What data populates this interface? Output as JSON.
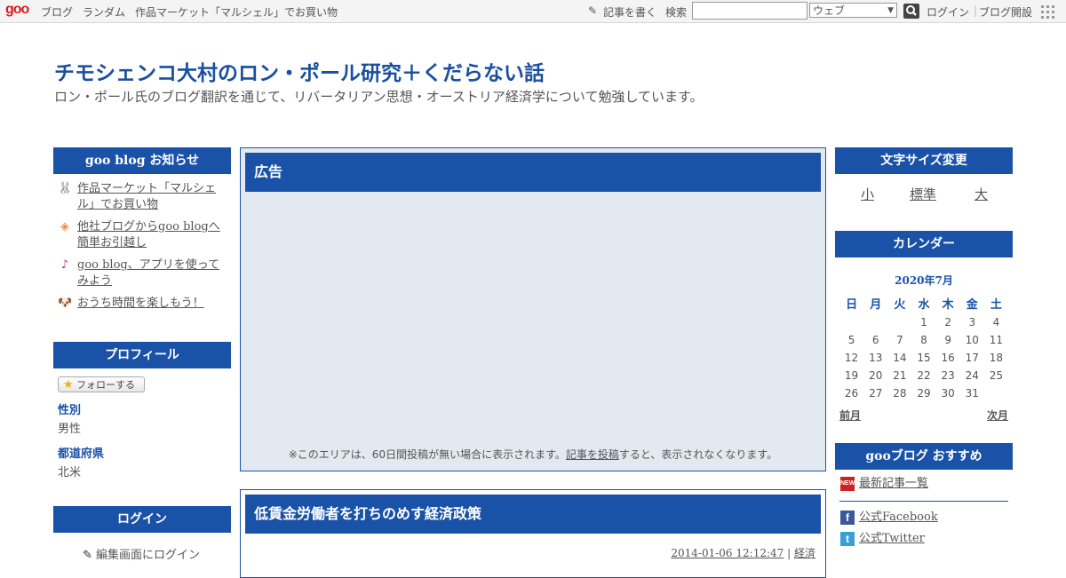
{
  "topbar": {
    "logo": "goo",
    "nav": [
      "ブログ",
      "ランダム",
      "作品マーケット「マルシェル」でお買い物"
    ],
    "write_label": "記事を書く",
    "search_label": "検索",
    "search_value": "",
    "search_scope": "ウェブ",
    "login": "ログイン",
    "open_blog": "ブログ開設"
  },
  "blog": {
    "title": "チモシェンコ大村のロン・ポール研究＋くだらない話",
    "description": "ロン・ポール氏のブログ翻訳を通じて、リバータリアン思想・オーストリア経済学について勉強しています。"
  },
  "left": {
    "notice_heading": "goo blog お知らせ",
    "notices": [
      {
        "icon": "bunny-icon",
        "label": "作品マーケット「マルシェル」でお買い物"
      },
      {
        "icon": "diamond-icon",
        "label": "他社ブログからgoo blogへ簡単お引越し"
      },
      {
        "icon": "music-note-icon",
        "label": "goo blog、アプリを使ってみよう"
      },
      {
        "icon": "dog-icon",
        "label": "おうち時間を楽しもう！"
      }
    ],
    "profile_heading": "プロフィール",
    "follow_label": "フォローする",
    "profile": [
      {
        "label": "性別",
        "value": "男性"
      },
      {
        "label": "都道府県",
        "value": "北米"
      }
    ],
    "login_heading": "ログイン",
    "login_link": "編集画面にログイン"
  },
  "main": {
    "ad_heading": "広告",
    "ad_note_prefix": "※このエリアは、60日間投稿が無い場合に表示されます。",
    "ad_note_link": "記事を投稿",
    "ad_note_suffix": "すると、表示されなくなります。",
    "article_title": "低賃金労働者を打ちのめす経済政策",
    "article_date": "2014-01-06 12:12:47",
    "article_separator": "|",
    "article_category": "経済"
  },
  "right": {
    "font_heading": "文字サイズ変更",
    "font_small": "小",
    "font_normal": "標準",
    "font_large": "大",
    "calendar_heading": "カレンダー",
    "calendar_month": "2020年7月",
    "weekdays": [
      "日",
      "月",
      "火",
      "水",
      "木",
      "金",
      "土"
    ],
    "weeks": [
      [
        "",
        "",
        "",
        "1",
        "2",
        "3",
        "4"
      ],
      [
        "5",
        "6",
        "7",
        "8",
        "9",
        "10",
        "11"
      ],
      [
        "12",
        "13",
        "14",
        "15",
        "16",
        "17",
        "18"
      ],
      [
        "19",
        "20",
        "21",
        "22",
        "23",
        "24",
        "25"
      ],
      [
        "26",
        "27",
        "28",
        "29",
        "30",
        "31",
        ""
      ]
    ],
    "prev_month": "前月",
    "next_month": "次月",
    "recommend_heading": "gooブログ おすすめ",
    "recommend": [
      {
        "icon": "new-icon",
        "icon_text": "NEW",
        "label": "最新記事一覧"
      },
      {
        "icon": "facebook-icon",
        "icon_text": "f",
        "label": "公式Facebook"
      },
      {
        "icon": "twitter-icon",
        "icon_text": "t",
        "label": "公式Twitter"
      }
    ]
  },
  "colors": {
    "accent": "#1a52a8",
    "ad_background": "#e3e9f1",
    "logo_red": "#d81e1e"
  }
}
